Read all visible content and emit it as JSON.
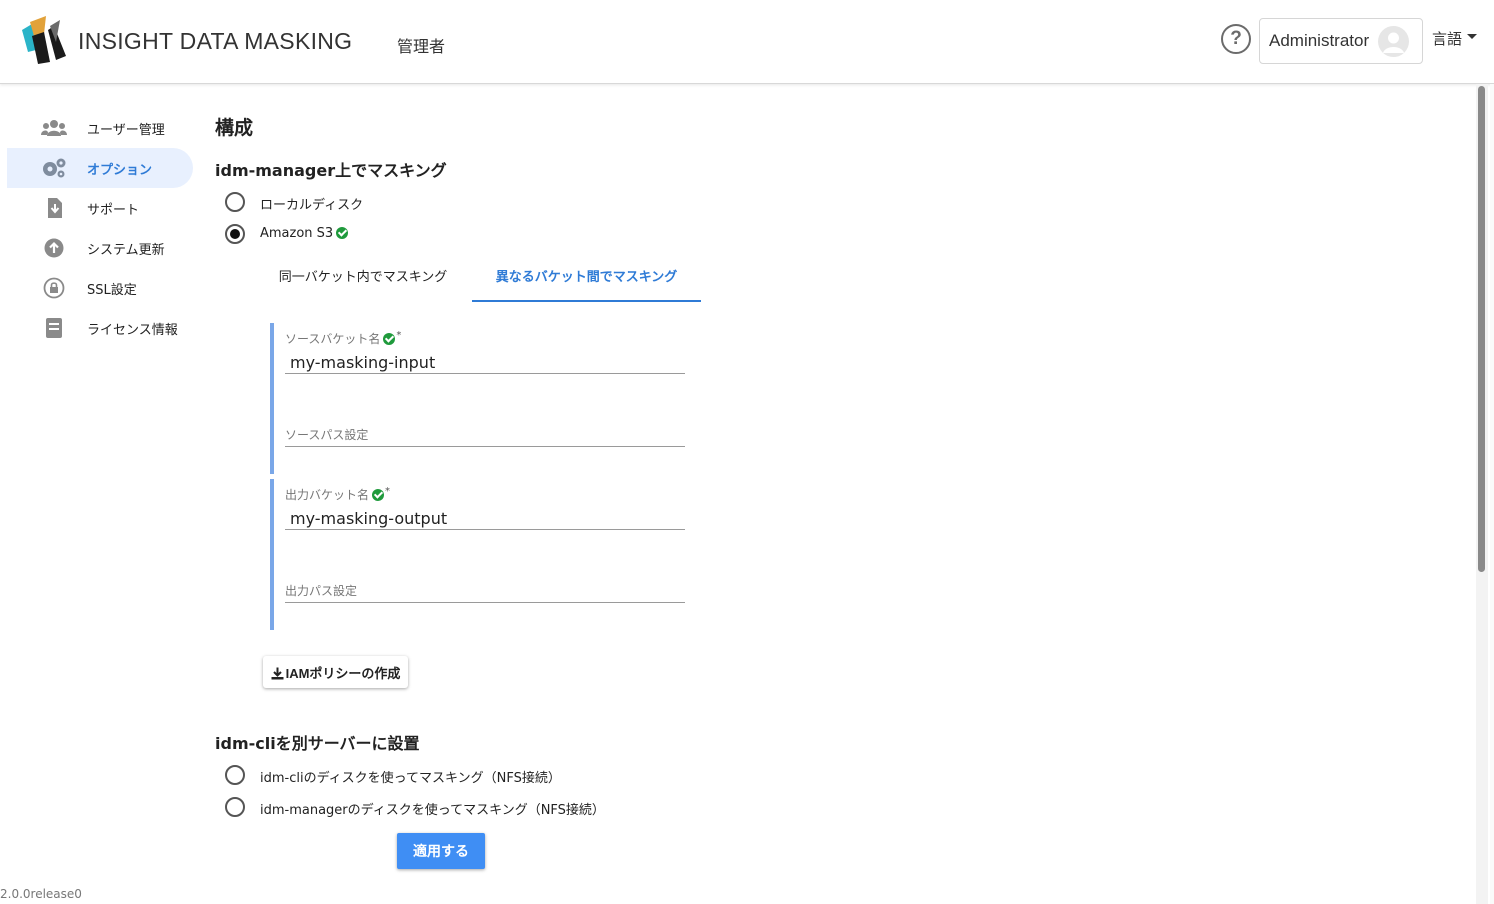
{
  "header": {
    "brand": "INSIGHT DATA MASKING",
    "role": "管理者",
    "help_glyph": "?",
    "username": "Administrator",
    "language_label": "言語"
  },
  "sidebar": {
    "items": [
      {
        "label": "ユーザー管理",
        "icon": "users-icon"
      },
      {
        "label": "オプション",
        "icon": "gears-icon",
        "active": true
      },
      {
        "label": "サポート",
        "icon": "file-download-icon"
      },
      {
        "label": "システム更新",
        "icon": "arrow-up-circle-icon"
      },
      {
        "label": "SSL設定",
        "icon": "lock-icon"
      },
      {
        "label": "ライセンス情報",
        "icon": "document-icon"
      }
    ]
  },
  "main": {
    "title": "構成",
    "section1": {
      "heading": "idm-manager上でマスキング",
      "options": [
        {
          "label": "ローカルディスク",
          "checked": false
        },
        {
          "label": "Amazon S3",
          "checked": true,
          "verified": true
        }
      ],
      "tabs": [
        {
          "label": "同一バケット内でマスキング",
          "active": false
        },
        {
          "label": "異なるバケット間でマスキング",
          "active": true
        }
      ],
      "source": {
        "bucket_label": "ソースバケット名",
        "bucket_required": "*",
        "bucket_value": "my-masking-input",
        "path_label": "ソースパス設定",
        "path_value": ""
      },
      "output": {
        "bucket_label": "出力バケット名",
        "bucket_required": "*",
        "bucket_value": "my-masking-output",
        "path_label": "出力パス設定",
        "path_value": ""
      },
      "iam_button": "IAMポリシーの作成"
    },
    "section2": {
      "heading": "idm-cliを別サーバーに設置",
      "options": [
        {
          "label": "idm-cliのディスクを使ってマスキング（NFS接続）",
          "checked": false
        },
        {
          "label": "idm-managerのディスクを使ってマスキング（NFS接続）",
          "checked": false
        }
      ]
    },
    "apply_button": "適用する"
  },
  "footer": {
    "version": "2.0.0release0"
  },
  "colors": {
    "accent": "#2f7bd6",
    "apply_button": "#3f8ef4",
    "nav_active_bg": "#e8f0fe",
    "verified": "#1f9a3c",
    "group_bar": "#7aa7e8"
  }
}
